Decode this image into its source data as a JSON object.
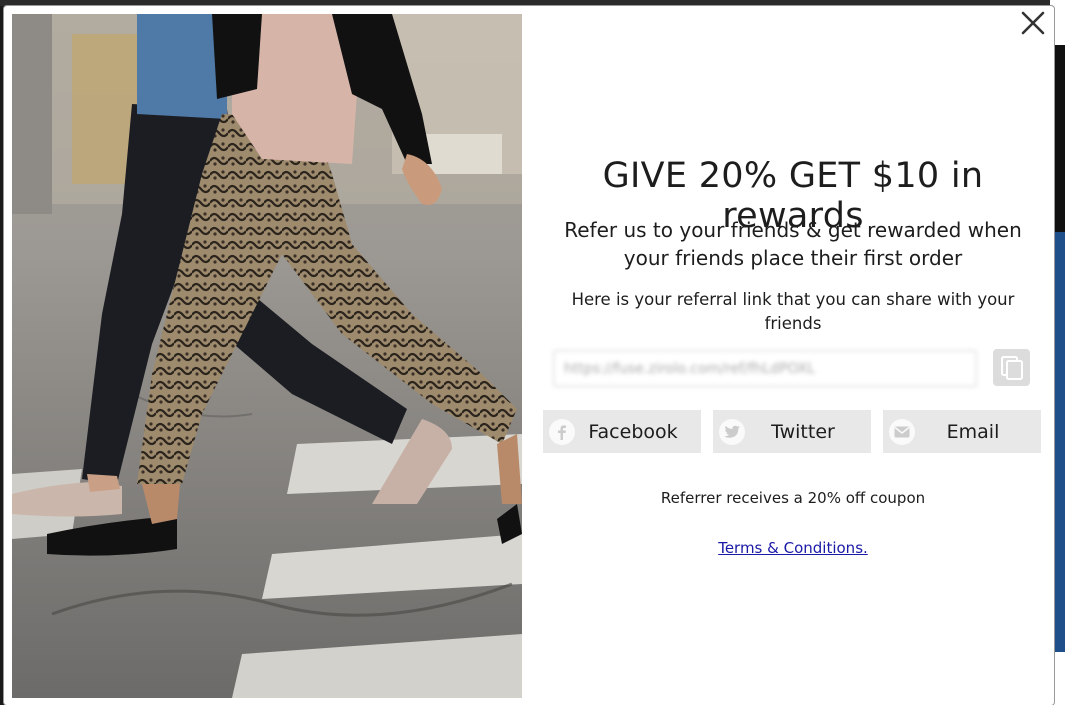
{
  "modal": {
    "title": "GIVE 20% GET $10 in rewards",
    "subtitle": "Refer us to your friends & get rewarded when your friends place their first order",
    "share_text": "Here is your referral link that you can share with your friends",
    "referral_link": "https://fuse.zirolo.com/ref/fhLdPOXL",
    "close_icon": "close-icon",
    "copy_icon": "copy-icon"
  },
  "share_buttons": {
    "facebook": "Facebook",
    "twitter": "Twitter",
    "email": "Email"
  },
  "coupon_text": "Referrer receives a 20% off coupon",
  "terms_link": "Terms & Conditions.",
  "colors": {
    "button_bg": "#e8e8e8",
    "link": "#1a1aa6",
    "copy_bg": "#dcdcdc"
  }
}
